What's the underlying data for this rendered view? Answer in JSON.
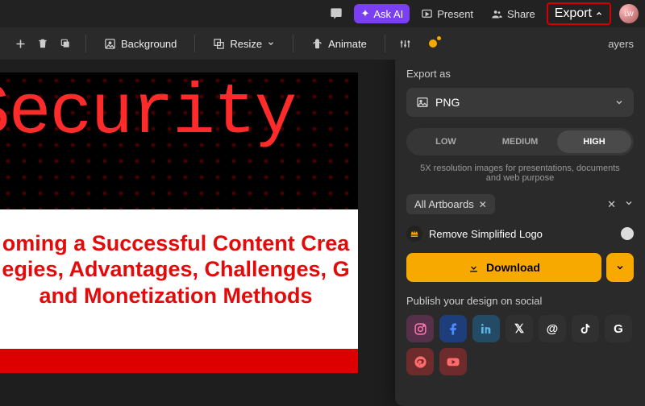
{
  "topbar": {
    "askAI": "Ask AI",
    "present": "Present",
    "share": "Share",
    "export": "Export",
    "layersSuffix": "ayers",
    "avatar": "LW"
  },
  "toolbar": {
    "background": "Background",
    "resize": "Resize",
    "animate": "Animate"
  },
  "artboard": {
    "heroWord": "Security",
    "line1": "oming a Successful Content Crea",
    "line2": "egies, Advantages, Challenges, G",
    "line3": "and Monetization Methods"
  },
  "export": {
    "title": "Export as",
    "format": "PNG",
    "quality": {
      "low": "LOW",
      "medium": "MEDIUM",
      "high": "HIGH"
    },
    "qualityDesc": "5X resolution images for presentations, documents and web purpose",
    "artboardsChip": "All Artboards",
    "removeLogo": "Remove Simplified Logo",
    "download": "Download",
    "publishTitle": "Publish your design on social"
  },
  "social": {
    "x": "𝕏",
    "threads": "@",
    "google": "G"
  }
}
